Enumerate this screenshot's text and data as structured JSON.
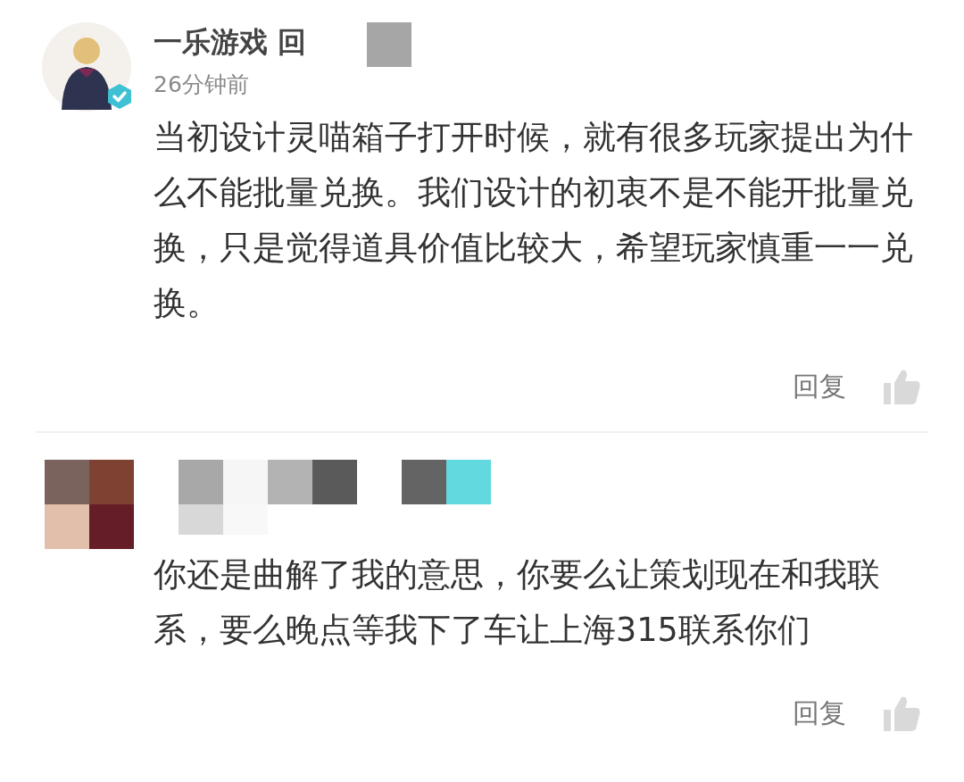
{
  "comments": [
    {
      "avatar": {
        "kind": "figure",
        "verified": true
      },
      "name": "一乐游戏 回",
      "name_redacted": true,
      "time": "26分钟前",
      "body": "当初设计灵喵箱子打开时候，就有很多玩家提出为什么不能批量兑换。我们设计的初衷不是不能开批量兑换，只是觉得道具价值比较大，希望玩家慎重一一兑换。",
      "reply": "回复"
    },
    {
      "avatar": {
        "kind": "mosaic"
      },
      "name_redacted": true,
      "body": "你还是曲解了我的意思，你要么让策划现在和我联系，要么晚点等我下了车让上海315联系你们",
      "reply": "回复"
    }
  ]
}
